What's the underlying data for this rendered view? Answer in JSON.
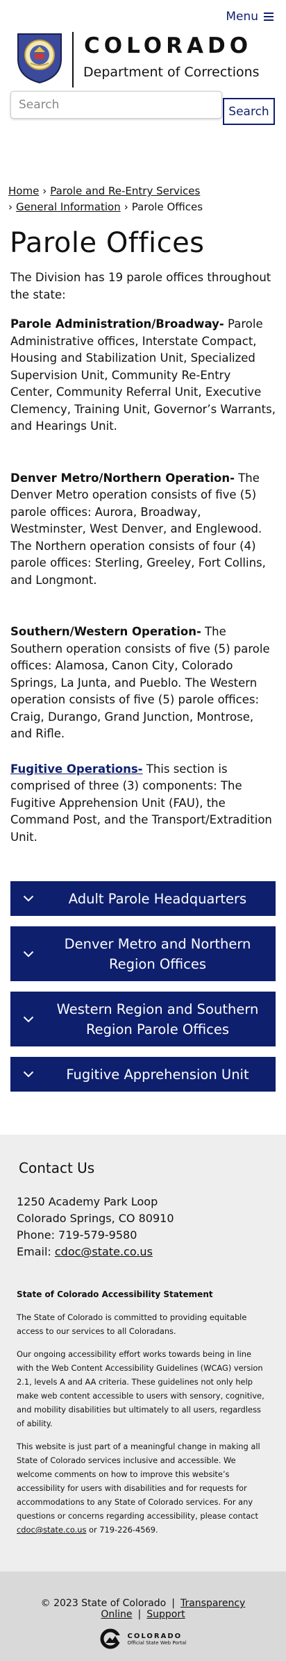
{
  "header": {
    "menu_label": "Menu",
    "brand_title": "COLORADO",
    "brand_subtitle": "Department of Corrections"
  },
  "search": {
    "placeholder": "Search",
    "button_label": "Search"
  },
  "breadcrumb": {
    "items": [
      "Home",
      "Parole and Re-Entry Services",
      "General Information",
      "Parole Offices"
    ],
    "separator": "›"
  },
  "page": {
    "title": "Parole Offices",
    "intro": "The Division has 19 parole offices throughout the state:",
    "sections": [
      {
        "heading": "Parole Administration/Broadway-",
        "text": " Parole Administrative offices, Interstate Compact, Housing and Stabilization Unit, Specialized Supervision Unit, Community Re-Entry Center, Community Referral Unit, Executive Clemency, Training Unit, Governor’s Warrants, and Hearings Unit."
      },
      {
        "heading": "Denver Metro/Northern Operation-",
        "text": " The Denver Metro operation consists of five (5) parole offices: Aurora, Broadway, Westminster, West Denver, and Englewood. The Northern operation consists of four (4) parole offices: Sterling, Greeley, Fort Collins, and Longmont."
      },
      {
        "heading": "Southern/Western Operation-",
        "text": " The Southern operation consists of five (5) parole offices: Alamosa, Canon City, Colorado Springs, La Junta, and Pueblo. The Western operation consists of five (5) parole offices: Craig, Durango, Grand Junction, Montrose, and Rifle."
      },
      {
        "heading": "Fugitive Operations-",
        "text": " This section is comprised of three (3) components: The Fugitive Apprehension Unit (FAU), the Command Post, and the Transport/Extradition Unit."
      }
    ]
  },
  "accordions": [
    "Adult Parole Headquarters",
    "Denver Metro and Northern Region Offices",
    "Western Region and Southern Region Parole Offices",
    "Fugitive Apprehension Unit"
  ],
  "footer": {
    "contact_title": "Contact Us",
    "address_line1": "1250 Academy Park Loop",
    "address_line2": "Colorado Springs, CO 80910",
    "phone": "Phone: 719-579-9580",
    "email_label": "Email: ",
    "email": "cdoc@state.co.us",
    "accessibility_title": "State of Colorado Accessibility Statement",
    "accessibility_p1": "The State of Colorado is committed to providing equitable access to our services to all Coloradans.",
    "accessibility_p2": "Our ongoing accessibility effort works towards being in line with the Web Content Accessibility Guidelines (WCAG) version 2.1, levels A and AA criteria. These guidelines not only help make web content accessible to users with sensory, cognitive, and mobility disabilities but ultimately to all users, regardless of ability.",
    "accessibility_p3a": "This website is just part of a meaningful change in making all State of Colorado services inclusive and accessible. We welcome comments on how to improve this website’s accessibility for users with disabilities and for requests for accommodations to any State of Colorado services. For any questions or concerns regarding accessibility, please contact ",
    "accessibility_email": "cdoc@state.co.us",
    "accessibility_p3b": " or 719-226-4569.",
    "copyright": "© 2023 State of Colorado",
    "transparency": "Transparency Online",
    "support": "Support",
    "portal_title": "COLORADO",
    "portal_sub": "Official State Web Portal"
  },
  "colors": {
    "accent": "#0e1f6e",
    "footer_bg": "#eeeeee",
    "bottom_bar_bg": "#d9d9d9"
  }
}
